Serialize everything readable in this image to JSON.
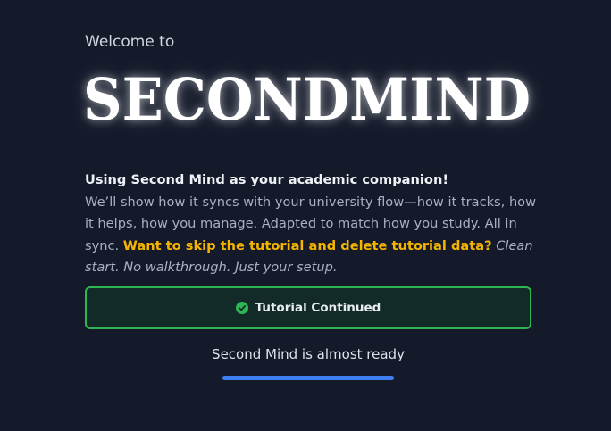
{
  "welcome": {
    "intro": "Welcome to",
    "brand": "SECONDMIND"
  },
  "description": {
    "heading": "Using Second Mind as your academic companion!",
    "body": "We’ll show how it syncs with your university flow—how it tracks, how it helps, how you manage. Adapted to match how you study. All in sync.",
    "skip_link": "Want to skip the tutorial and delete tutorial data?",
    "skip_note": "Clean start. No walkthrough. Just your setup."
  },
  "status": {
    "label": "Tutorial Continued",
    "icon": "check-circle-icon",
    "color": "#2fb552"
  },
  "loading": {
    "text": "Second Mind is almost ready",
    "progress": 1.0,
    "color": "#3d7ef0"
  }
}
